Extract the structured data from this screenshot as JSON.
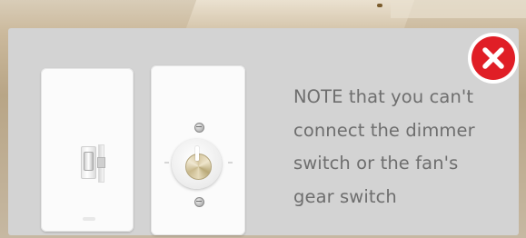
{
  "dialog": {
    "note_text": "NOTE that you can't connect the dimmer switch or the fan's gear switch",
    "close_icon": "close-icon",
    "colors": {
      "panel": "#d3d3d3",
      "note_text": "#6e6e6e",
      "close_red": "#e01e26",
      "close_ring": "#ffffff"
    },
    "images": [
      {
        "name": "dimmer-switch-image",
        "depicts": "toggle dimmer switch plate"
      },
      {
        "name": "fan-speed-switch-image",
        "depicts": "rotary fan gear switch plate"
      }
    ]
  }
}
